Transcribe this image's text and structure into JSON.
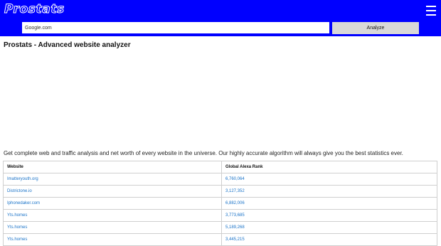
{
  "header": {
    "logo": "Prostats"
  },
  "search": {
    "value": "Google.com",
    "placeholder": ""
  },
  "analyze_label": "Analyze",
  "page_title": "Prostats - Advanced website analyzer",
  "description": "Get complete web and traffic analysis and net worth of every website in the universe. Our highly accurate algorithm will always give you the best statistics ever.",
  "table": {
    "headers": [
      "Website",
      "Global Alexa Rank"
    ],
    "rows": [
      {
        "site": "Imatteryouth.org",
        "rank": "6,760,064"
      },
      {
        "site": "Districtone.io",
        "rank": "3,127,352"
      },
      {
        "site": "Iphonedaker.com",
        "rank": "6,882,006"
      },
      {
        "site": "Yts.homes",
        "rank": "3,773,685"
      },
      {
        "site": "Yts.homes",
        "rank": "5,189,268"
      },
      {
        "site": "Yts.homes",
        "rank": "3,445,215"
      }
    ]
  },
  "colors": {
    "header_bg": "#0000ff",
    "link": "#1a73c8"
  }
}
